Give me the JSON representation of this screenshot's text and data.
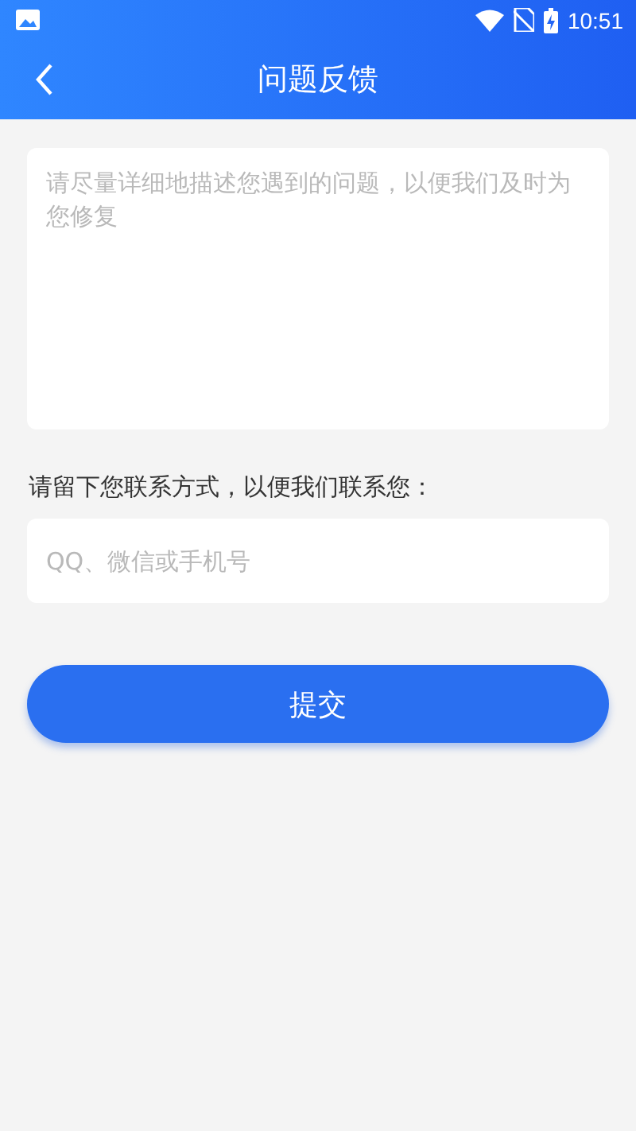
{
  "status_bar": {
    "time": "10:51"
  },
  "header": {
    "title": "问题反馈"
  },
  "feedback": {
    "placeholder": "请尽量详细地描述您遇到的问题，以便我们及时为您修复"
  },
  "contact": {
    "label": "请留下您联系方式，以便我们联系您：",
    "placeholder": "QQ、微信或手机号"
  },
  "submit": {
    "label": "提交"
  }
}
